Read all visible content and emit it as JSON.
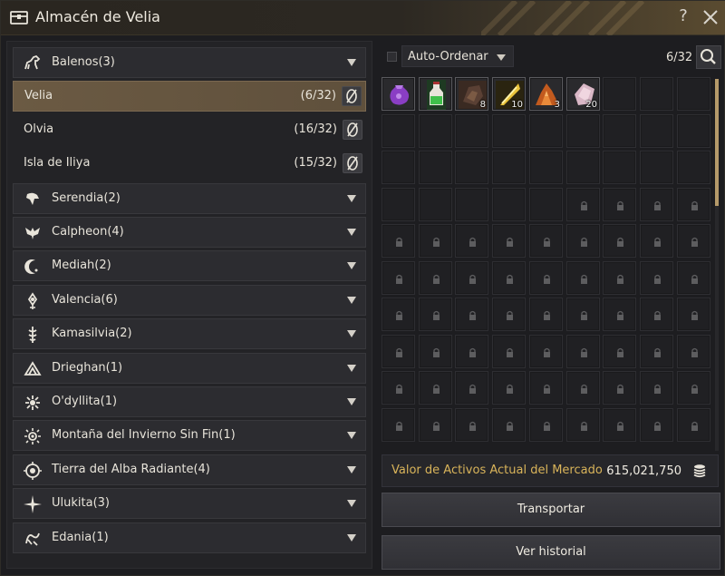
{
  "window": {
    "title": "Almacén de Velia"
  },
  "regions": [
    {
      "label": "Balenos(3)",
      "icon": "horse-icon",
      "expanded": true,
      "cities": [
        {
          "name": "Velia",
          "count": "(6/32)",
          "selected": true
        },
        {
          "name": "Olvia",
          "count": "(16/32)",
          "selected": false
        },
        {
          "name": "Isla de Iliya",
          "count": "(15/32)",
          "selected": false
        }
      ]
    },
    {
      "label": "Serendia(2)",
      "icon": "eagle-icon"
    },
    {
      "label": "Calpheon(4)",
      "icon": "winged-crest-icon"
    },
    {
      "label": "Mediah(2)",
      "icon": "crescent-moon-icon"
    },
    {
      "label": "Valencia(6)",
      "icon": "sun-emblem-icon"
    },
    {
      "label": "Kamasilvia(2)",
      "icon": "tree-emblem-icon"
    },
    {
      "label": "Drieghan(1)",
      "icon": "mountain-emblem-icon"
    },
    {
      "label": "O'dyllita(1)",
      "icon": "flower-emblem-icon"
    },
    {
      "label": "Montaña del Invierno Sin Fin(1)",
      "icon": "snow-sun-icon"
    },
    {
      "label": "Tierra del Alba Radiante(4)",
      "icon": "dawn-emblem-icon"
    },
    {
      "label": "Ulukita(3)",
      "icon": "compass-star-icon"
    },
    {
      "label": "Edania(1)",
      "icon": "rune-emblem-icon"
    }
  ],
  "storage": {
    "sort_label": "Auto-Ordenar",
    "capacity": "6/32",
    "items": [
      {
        "name": "purple-pouch-icon",
        "qty": ""
      },
      {
        "name": "green-potion-icon",
        "qty": ""
      },
      {
        "name": "dark-ore-icon",
        "qty": "8"
      },
      {
        "name": "golden-feather-icon",
        "qty": "10"
      },
      {
        "name": "copper-ore-icon",
        "qty": "3"
      },
      {
        "name": "pink-crystal-icon",
        "qty": "20"
      }
    ],
    "total_slots": 32,
    "visible_slots": 90
  },
  "market": {
    "label": "Valor de Activos Actual del Mercado",
    "value": "615,021,750"
  },
  "buttons": {
    "transport": "Transportar",
    "history": "Ver historial"
  },
  "colors": {
    "accent_gold": "#d9b45a",
    "selected_row": "#6b5a43",
    "scroll_thumb": "#b59a6a"
  }
}
